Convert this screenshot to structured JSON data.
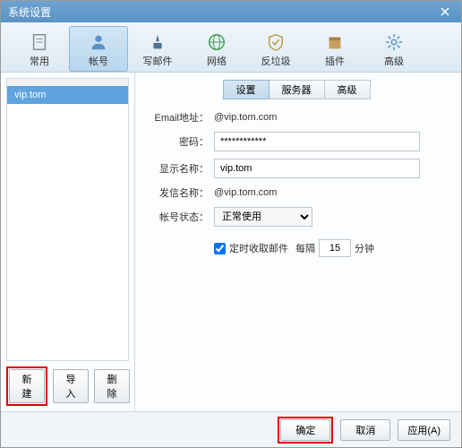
{
  "titlebar": {
    "title": "系统设置"
  },
  "toolbar": {
    "items": [
      {
        "label": "常用"
      },
      {
        "label": "帐号"
      },
      {
        "label": "写邮件"
      },
      {
        "label": "网络"
      },
      {
        "label": "反垃圾"
      },
      {
        "label": "插件"
      },
      {
        "label": "高级"
      }
    ]
  },
  "sidebar": {
    "accounts": [
      {
        "display": ""
      },
      {
        "display": "vip.tom"
      }
    ],
    "btn_new": "新建",
    "btn_import": "导入",
    "btn_delete": "删除"
  },
  "subtabs": {
    "t0": "设置",
    "t1": "服务器",
    "t2": "高级"
  },
  "form": {
    "email_label": "Email地址：",
    "email_value": "@vip.tom.com",
    "pwd_label": "密码：",
    "pwd_value": "************",
    "disp_label": "显示名称：",
    "disp_value": "vip.tom",
    "sender_label": "发信名称：",
    "sender_value": "@vip.tom.com",
    "status_label": "帐号状态：",
    "status_value": "正常使用",
    "check_enabled": true,
    "check_text1": "定时收取邮件",
    "check_text2": "每隔",
    "interval": "15",
    "check_text3": "分钟"
  },
  "footer": {
    "ok": "确定",
    "cancel": "取消",
    "apply": "应用(A)"
  }
}
